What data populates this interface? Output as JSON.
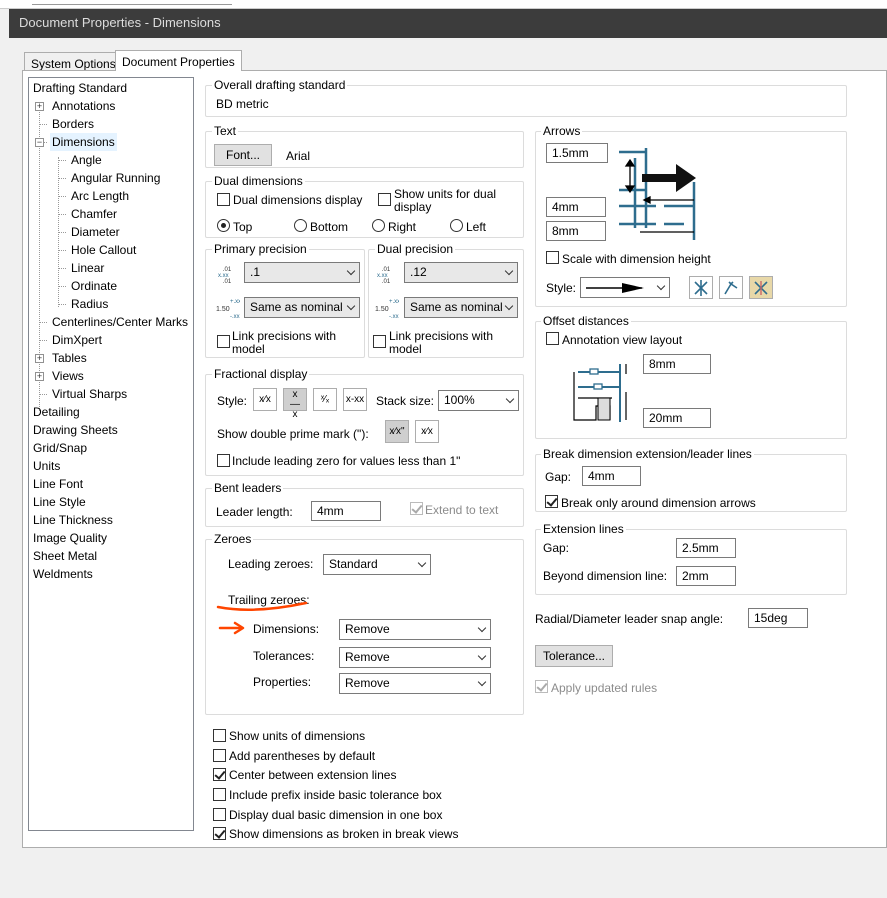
{
  "window": {
    "title": "Document Properties - Dimensions"
  },
  "tabs": [
    {
      "label": "System Options"
    },
    {
      "label": "Document Properties"
    }
  ],
  "tree": {
    "items": [
      {
        "label": "Drafting Standard"
      },
      {
        "label": "Annotations"
      },
      {
        "label": "Borders"
      },
      {
        "label": "Dimensions"
      },
      {
        "label": "Angle"
      },
      {
        "label": "Angular Running"
      },
      {
        "label": "Arc Length"
      },
      {
        "label": "Chamfer"
      },
      {
        "label": "Diameter"
      },
      {
        "label": "Hole Callout"
      },
      {
        "label": "Linear"
      },
      {
        "label": "Ordinate"
      },
      {
        "label": "Radius"
      },
      {
        "label": "Centerlines/Center Marks"
      },
      {
        "label": "DimXpert"
      },
      {
        "label": "Tables"
      },
      {
        "label": "Views"
      },
      {
        "label": "Virtual Sharps"
      },
      {
        "label": "Detailing"
      },
      {
        "label": "Drawing Sheets"
      },
      {
        "label": "Grid/Snap"
      },
      {
        "label": "Units"
      },
      {
        "label": "Line Font"
      },
      {
        "label": "Line Style"
      },
      {
        "label": "Line Thickness"
      },
      {
        "label": "Image Quality"
      },
      {
        "label": "Sheet Metal"
      },
      {
        "label": "Weldments"
      }
    ]
  },
  "overall": {
    "title": "Overall drafting standard",
    "value": "BD metric"
  },
  "text": {
    "title": "Text",
    "font_button": "Font...",
    "font_name": "Arial"
  },
  "dual": {
    "title": "Dual dimensions",
    "display_label": "Dual dimensions display",
    "show_units_label_1": "Show units for dual",
    "show_units_label_2": "display",
    "top": "Top",
    "bottom": "Bottom",
    "right": "Right",
    "left": "Left"
  },
  "primary_precision": {
    "title": "Primary precision",
    "value": ".1",
    "tolerance": "Same as nominal",
    "link_1": "Link precisions with",
    "link_2": "model",
    "icon_top": ".01",
    "icon_bottom": "1.50"
  },
  "dual_precision": {
    "title": "Dual precision",
    "value": ".12",
    "tolerance": "Same as nominal",
    "link_1": "Link precisions with",
    "link_2": "model"
  },
  "fractional": {
    "title": "Fractional display",
    "style_label": "Style:",
    "stack_label": "Stack size:",
    "stack_value": "100%",
    "double_prime_label": "Show double prime mark (\"):",
    "leading_zero_label": "Include leading zero for values less than 1\""
  },
  "bent": {
    "title": "Bent leaders",
    "length_label": "Leader length:",
    "length_value": "4mm",
    "extend_label": "Extend to text"
  },
  "zeroes": {
    "title": "Zeroes",
    "leading_label": "Leading zeroes:",
    "leading_value": "Standard",
    "trailing_label": "Trailing zeroes:",
    "dimensions_label": "Dimensions:",
    "dimensions_value": "Remove",
    "tolerances_label": "Tolerances:",
    "tolerances_value": "Remove",
    "properties_label": "Properties:",
    "properties_value": "Remove"
  },
  "bottom_checks": [
    {
      "label": "Show units of dimensions",
      "checked": false
    },
    {
      "label": "Add parentheses by default",
      "checked": false
    },
    {
      "label": "Center between extension lines",
      "checked": true
    },
    {
      "label": "Include prefix inside basic tolerance box",
      "checked": false
    },
    {
      "label": "Display dual basic dimension in one box",
      "checked": false
    },
    {
      "label": "Show dimensions as broken in break views",
      "checked": true
    }
  ],
  "arrows": {
    "title": "Arrows",
    "size1": "1.5mm",
    "size2": "4mm",
    "size3": "8mm",
    "scale_label": "Scale with dimension height",
    "style_label": "Style:"
  },
  "offset": {
    "title": "Offset distances",
    "annotation_label": "Annotation view layout",
    "value1": "8mm",
    "value2": "20mm"
  },
  "break": {
    "title": "Break dimension extension/leader lines",
    "gap_label": "Gap:",
    "gap_value": "4mm",
    "only_label": "Break only around dimension arrows"
  },
  "extension": {
    "title": "Extension lines",
    "gap_label": "Gap:",
    "gap_value": "2.5mm",
    "beyond_label": "Beyond dimension line:",
    "beyond_value": "2mm"
  },
  "snap": {
    "label": "Radial/Diameter leader snap angle:",
    "value": "15deg"
  },
  "tolerance_button": "Tolerance...",
  "apply_label": "Apply updated rules",
  "colors": {
    "accent_blue": "#2e6d8e",
    "annotation_orange": "#ff4500"
  }
}
